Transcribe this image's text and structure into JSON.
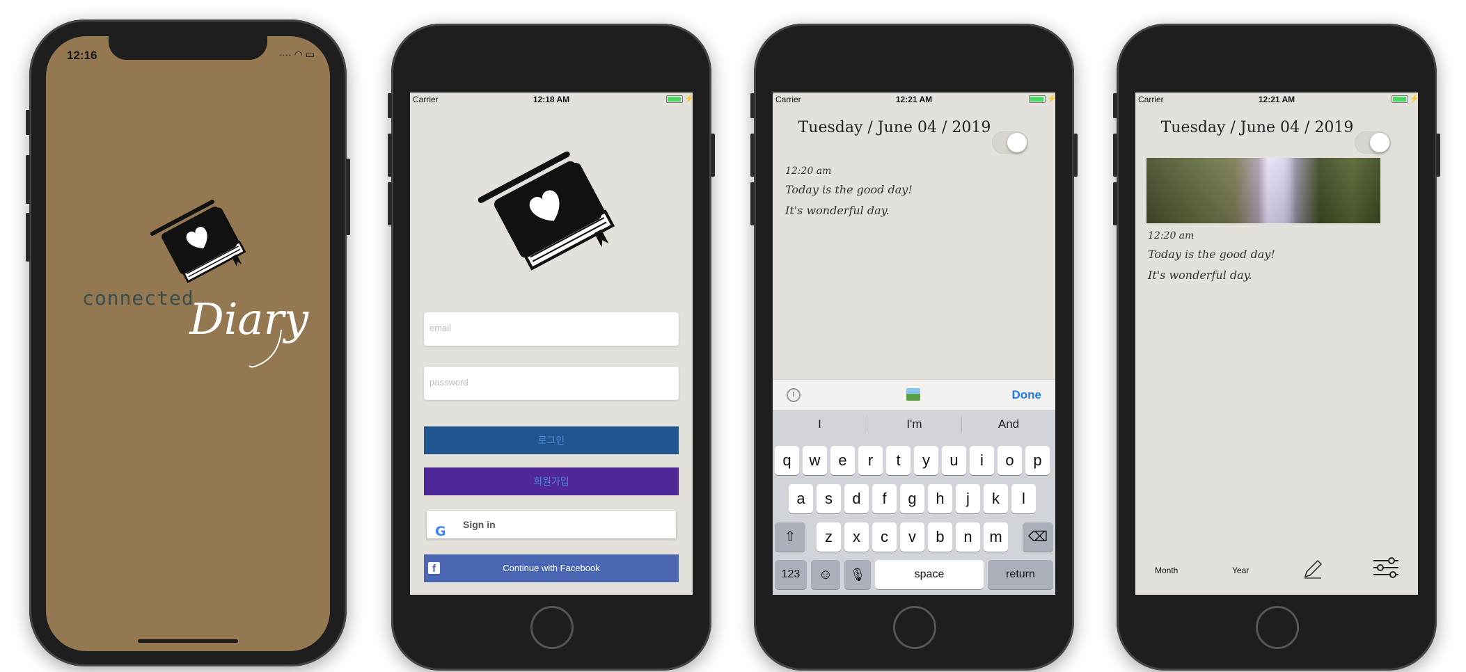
{
  "splash": {
    "time": "12:16",
    "status_icons": "···· ◠ ▭",
    "brand_connected": "connected",
    "brand_diary": "Diary"
  },
  "login": {
    "status": {
      "carrier": "Carrier",
      "time": "12:18 AM"
    },
    "email_placeholder": "email",
    "password_placeholder": "password",
    "login_label": "로그인",
    "join_label": "회원가입",
    "google_label": "Sign in",
    "google_logo": "G",
    "facebook_label": "Continue with Facebook",
    "facebook_logo": "f"
  },
  "diary_edit": {
    "status": {
      "carrier": "Carrier",
      "time": "12:21 AM"
    },
    "date": "Tuesday / June 04 / 2019",
    "entry_time": "12:20 am",
    "lines": [
      "Today is the good day!",
      "It's wonderful day."
    ],
    "toolbar_done": "Done",
    "suggestions": [
      "I",
      "I'm",
      "And"
    ],
    "keys_row1": [
      "q",
      "w",
      "e",
      "r",
      "t",
      "y",
      "u",
      "i",
      "o",
      "p"
    ],
    "keys_row2": [
      "a",
      "s",
      "d",
      "f",
      "g",
      "h",
      "j",
      "k",
      "l"
    ],
    "keys_row3": [
      "z",
      "x",
      "c",
      "v",
      "b",
      "n",
      "m"
    ],
    "key_shift": "⇧",
    "key_delete": "⌫",
    "key_numbers": "123",
    "key_emoji": "☺",
    "key_mic": "🎙",
    "key_space": "space",
    "key_return": "return"
  },
  "diary_view": {
    "status": {
      "carrier": "Carrier",
      "time": "12:21 AM"
    },
    "date": "Tuesday / June 04 / 2019",
    "entry_time": "12:20 am",
    "lines": [
      "Today is the good day!",
      "It's wonderful day."
    ],
    "bottom_month": "Month",
    "bottom_year": "Year"
  }
}
